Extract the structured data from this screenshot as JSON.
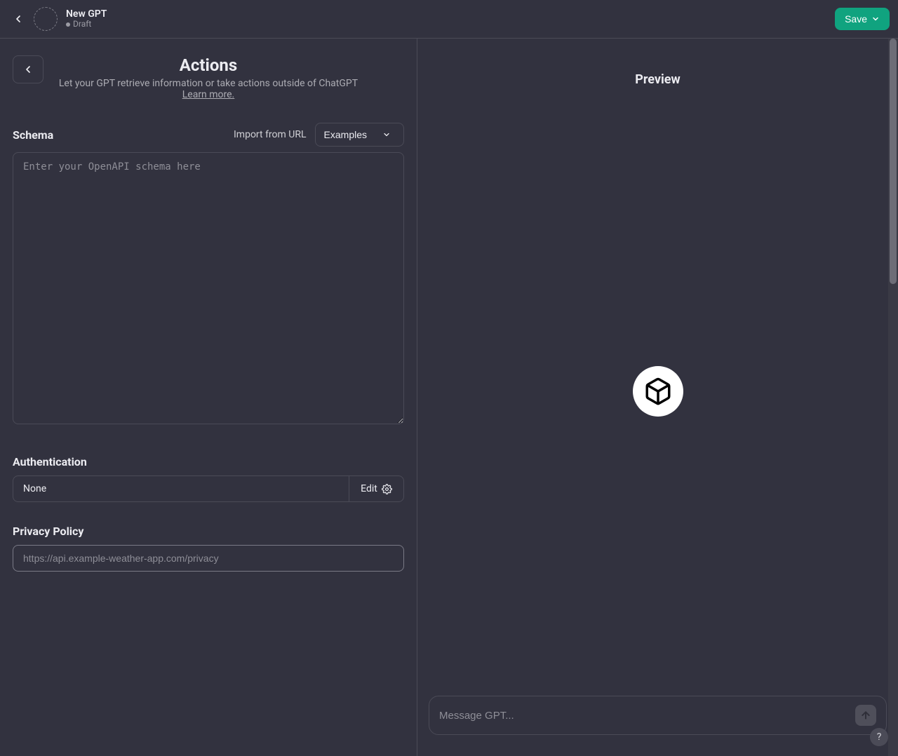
{
  "topbar": {
    "title": "New GPT",
    "status": "Draft",
    "save_label": "Save"
  },
  "left": {
    "actions_title": "Actions",
    "actions_desc": "Let your GPT retrieve information or take actions outside of ChatGPT",
    "learn_more": "Learn more.",
    "schema_label": "Schema",
    "import_url_label": "Import from URL",
    "examples_label": "Examples",
    "schema_placeholder": "Enter your OpenAPI schema here",
    "schema_value": "",
    "auth_label": "Authentication",
    "auth_value": "None",
    "auth_edit_label": "Edit",
    "pp_label": "Privacy Policy",
    "pp_placeholder": "https://api.example-weather-app.com/privacy",
    "pp_value": ""
  },
  "right": {
    "preview_label": "Preview",
    "message_placeholder": "Message GPT..."
  },
  "help_label": "?"
}
